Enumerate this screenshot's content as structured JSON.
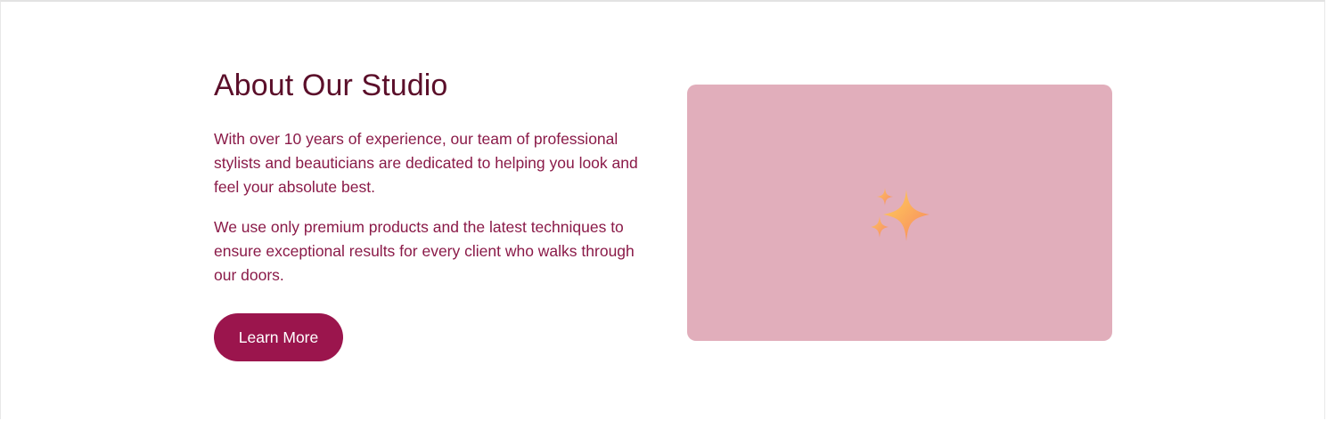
{
  "about": {
    "title": "About Our Studio",
    "paragraphs": [
      "With over 10 years of experience, our team of professional stylists and beauticians are dedicated to helping you look and feel your absolute best.",
      "We use only premium products and the latest techniques to ensure exceptional results for every client who walks through our doors."
    ],
    "button_label": "Learn More"
  },
  "image_card": {
    "icon": "sparkles-icon",
    "background_color": "#e1aebb"
  },
  "colors": {
    "title": "#5b0f2a",
    "body_text": "#8a1a48",
    "button_bg": "#9b154d",
    "button_text": "#ffffff"
  }
}
